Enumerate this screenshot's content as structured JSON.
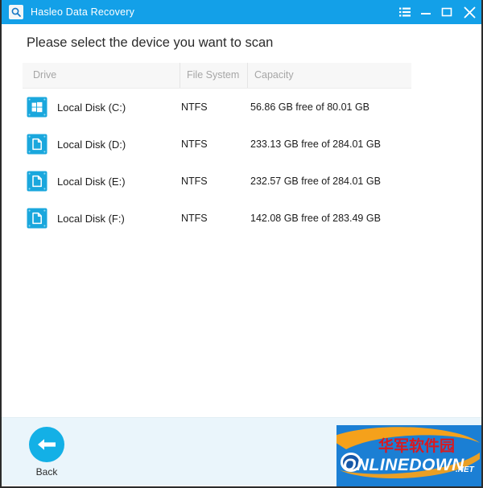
{
  "window": {
    "title": "Hasleo Data Recovery",
    "app_icon": "magnifier-icon",
    "controls": {
      "menu": "menu-list-icon",
      "minimize": "minimize-icon",
      "maximize": "maximize-icon",
      "close": "close-icon"
    }
  },
  "main": {
    "heading": "Please select the device you want to scan",
    "table": {
      "columns": [
        "Drive",
        "File System",
        "Capacity"
      ],
      "rows": [
        {
          "icon": "windows-system-drive-icon",
          "drive": "Local Disk (C:)",
          "file_system": "NTFS",
          "capacity": "56.86 GB free of 80.01 GB"
        },
        {
          "icon": "data-drive-icon",
          "drive": "Local Disk (D:)",
          "file_system": "NTFS",
          "capacity": "233.13 GB free of 284.01 GB"
        },
        {
          "icon": "data-drive-icon",
          "drive": "Local Disk (E:)",
          "file_system": "NTFS",
          "capacity": "232.57 GB free of 284.01 GB"
        },
        {
          "icon": "data-drive-icon",
          "drive": "Local Disk (F:)",
          "file_system": "NTFS",
          "capacity": "142.08 GB free of 283.49 GB"
        }
      ]
    }
  },
  "footer": {
    "back_label": "Back",
    "back_icon": "arrow-left-icon"
  },
  "watermark": {
    "chinese_text": "华军软件园",
    "brand_text": "ONLINEDOWN",
    "tld_text": ".NET"
  },
  "colors": {
    "titlebar": "#13a0e8",
    "accent": "#13b0e6",
    "drive_icon": "#1aa7dd",
    "footer_bg": "#eaf5fb",
    "header_text": "#a6a6a6",
    "watermark_bg": "#1b7fd4",
    "watermark_red": "#d81a20",
    "watermark_orange": "#f5a11b"
  }
}
